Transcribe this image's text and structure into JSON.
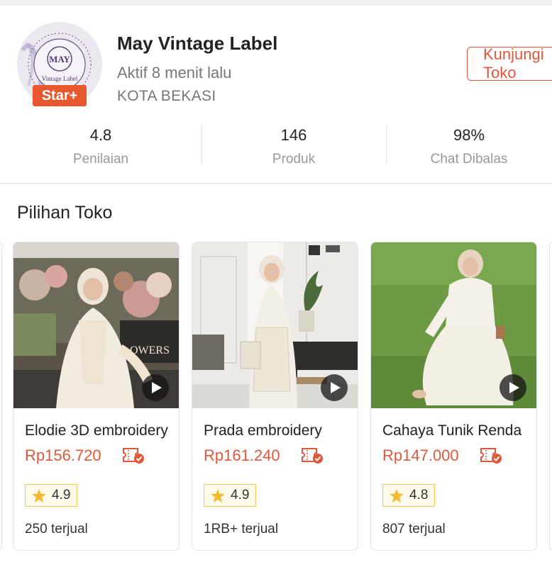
{
  "shop": {
    "name": "May Vintage Label",
    "active": "Aktif 8 menit lalu",
    "city": "KOTA BEKASI",
    "badge": "Star+",
    "logo_text": "MAY",
    "logo_subtext": "Vintage Label",
    "visit_label": "Kunjungi Toko",
    "accent": "#e0583a"
  },
  "stats": [
    {
      "value": "4.8",
      "label": "Penilaian"
    },
    {
      "value": "146",
      "label": "Produk"
    },
    {
      "value": "98%",
      "label": "Chat Dibalas"
    }
  ],
  "section": {
    "title": "Pilihan Toko"
  },
  "products": [
    {
      "title": "Elodie 3D embroidery",
      "price": "Rp156.720",
      "rating": "4.9",
      "sold": "250 terjual",
      "scene": "florist"
    },
    {
      "title": "Prada embroidery",
      "price": "Rp161.240",
      "rating": "4.9",
      "sold": "1RB+ terjual",
      "scene": "studio"
    },
    {
      "title": "Cahaya Tunik Renda",
      "price": "Rp147.000",
      "rating": "4.8",
      "sold": "807 terjual",
      "scene": "grass"
    }
  ]
}
